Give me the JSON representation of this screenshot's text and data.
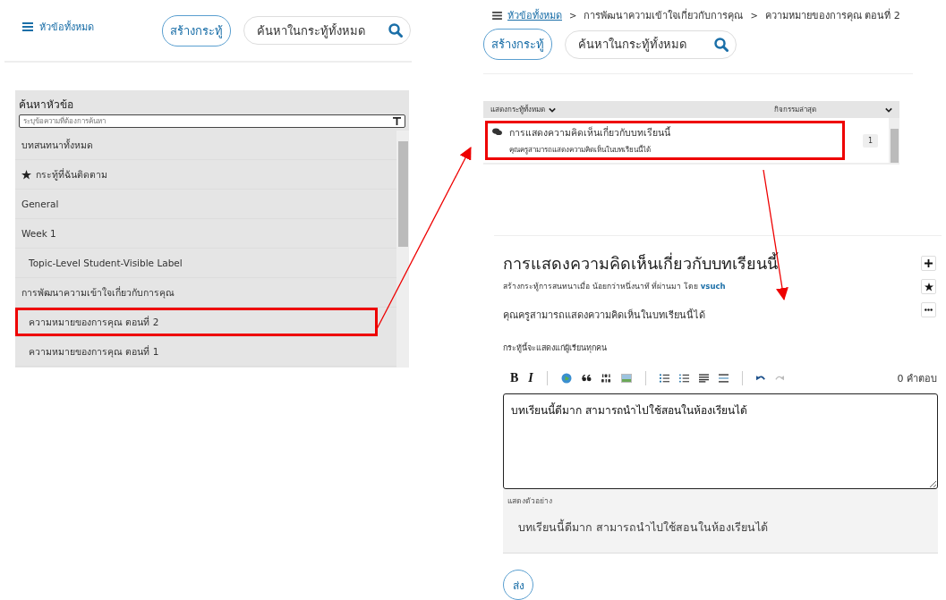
{
  "left": {
    "all_topics_link": "หัวข้อทั้งหมด",
    "create_button": "สร้างกระทู้",
    "search": {
      "placeholder": "ค้นหาในกระทู้ทั้งหมด"
    },
    "topic_panel": {
      "title": "ค้นหาหัวข้อ",
      "filter": {
        "placeholder": "ระบุข้อความที่ต้องการค้นหา"
      },
      "items": [
        {
          "kind": "all",
          "label": "บทสนทนาทั้งหมด",
          "highlighted": false
        },
        {
          "kind": "followed",
          "label": "กระทู้ที่ฉันติดตาม",
          "highlighted": false
        },
        {
          "kind": "topic",
          "label": "General",
          "highlighted": false
        },
        {
          "kind": "topic",
          "label": "Week 1",
          "highlighted": false,
          "children": [
            {
              "label": "Topic-Level Student-Visible Label",
              "highlighted": false
            }
          ]
        },
        {
          "kind": "topic",
          "label": "การพัฒนาความเข้าใจเกี่ยวกับการคุณ",
          "highlighted": false,
          "children": [
            {
              "label": "ความหมายของการคุณ ตอนที่ 2",
              "highlighted": true
            },
            {
              "label": "ความหมายของการคุณ ตอนที่ 1",
              "highlighted": false
            }
          ]
        }
      ]
    }
  },
  "right": {
    "breadcrumb": [
      "หัวข้อทั้งหมด",
      "การพัฒนาความเข้าใจเกี่ยวกับการคุณ",
      "ความหมายของการคุณ ตอนที่ 2"
    ],
    "breadcrumb_separator": ">",
    "create_button": "สร้างกระทู้",
    "search": {
      "placeholder": "ค้นหาในกระทู้ทั้งหมด"
    },
    "thread_list": {
      "filter_label": "แสดงกระทู้ทั้งหมด",
      "sort_label": "กิจกรรมล่าสุด",
      "rows": [
        {
          "title": "การแสดงความคิดเห็นเกี่ยวกับบทเรียนนี้",
          "preview": "คุณครูสามารถแสดงความคิดเห็นในบทเรียนนี้ได้",
          "count": "1",
          "highlighted": true
        }
      ]
    },
    "thread": {
      "title": "การแสดงความคิดเห็นเกี่ยวกับบทเรียนนี้",
      "meta": "สร้างกระทู้การสนทนาเมื่อ น้อยกว่าหนึ่งนาที ที่ผ่านมา โดย",
      "author": "vsuch",
      "body": "คุณครูสามารถแสดงความคิดเห็นในบทเรียนนี้ได้",
      "visibility_note": "กระทู้นี้จะแสดงแก่ผู้เรียนทุกคน",
      "toolbar": {
        "bold": "B",
        "italic": "I"
      },
      "reply_count": "0 คำตอบ",
      "reply_field": {
        "value": "บทเรียนนี้ดีมาก สามารถนำไปใช้สอนในห้องเรียนได้"
      },
      "preview_label": "แสดงตัวอย่าง",
      "preview_text": "บทเรียนนี้ดีมาก สามารถนำไปใช้สอนในห้องเรียนได้",
      "submit_button": "ส่ง"
    }
  }
}
